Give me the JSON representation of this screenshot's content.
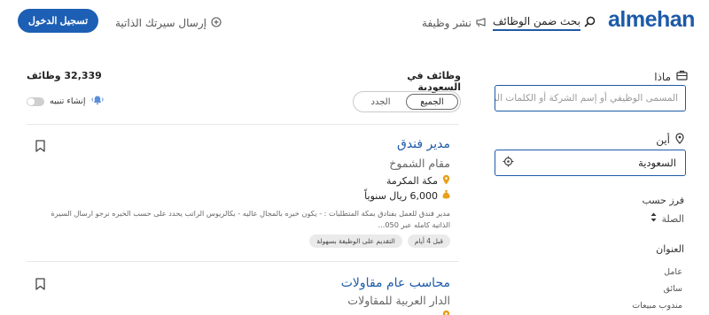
{
  "header": {
    "logo": "almehan",
    "nav_search": "بحث ضمن الوظائف",
    "nav_post": "نشر وظيفة",
    "nav_cv": "إرسال سيرتك الذاتية",
    "login": "تسجيل الدخول"
  },
  "sidebar": {
    "what_label": "ماذا",
    "what_placeholder": "المسمى الوظيفي أو إسم الشركة أو الكلمات الم",
    "where_label": "أين",
    "where_value": "السعودية",
    "sort_label": "فرز حسب",
    "sort_value": "الصلة",
    "title_label": "العنوان",
    "titles": [
      "عامل",
      "سائق",
      "مندوب مبيعات"
    ]
  },
  "results": {
    "count": "32,339 وظائف",
    "region": "وظائف في السعودية",
    "tabs": [
      "الجميع",
      "الجدد"
    ],
    "active_tab": "الجميع",
    "alert_label": "إنشاء تنبيه"
  },
  "jobs": [
    {
      "title": "مدير فندق",
      "company": "مقام الشموخ",
      "location": "مكة المكرمة",
      "salary": "6,000 ريال سنوياً",
      "description": "مدير فندق للعمل بفنادق بمكة المتطلبات : - يكون خبره بالمجال عاليه - بكالريوس الراتب يحدد على حسب الخبره نرجو ارسال السيرة الذاتية كامله عبر 050...",
      "posted": "قبل 4 أيام",
      "easy_apply": "التقديم على الوظيفة بسهولة"
    },
    {
      "title": "محاسب عام مقاولات",
      "company": "الدار العربية للمقاولات"
    }
  ],
  "colors": {
    "brand": "#1d5aa8",
    "button": "#1d5fb4",
    "location_pin": "#e6a01a"
  },
  "icons": {
    "nav_search": "search-icon",
    "nav_post": "megaphone-icon",
    "nav_cv": "add-circle-icon",
    "what": "briefcase-icon",
    "where": "location-pin-icon",
    "locate": "crosshair-icon",
    "sort": "sort-arrows-icon",
    "alert": "bell-icon",
    "bookmark": "bookmark-icon",
    "salary": "money-bag-icon"
  }
}
